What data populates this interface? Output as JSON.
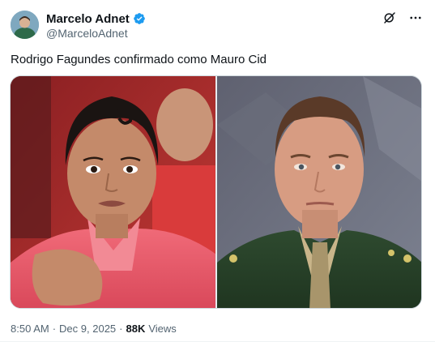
{
  "author": {
    "display_name": "Marcelo Adnet",
    "handle": "@MarceloAdnet",
    "verified": true
  },
  "post": {
    "text": "Rodrigo Fagundes confirmado como Mauro Cid",
    "time": "8:50 AM",
    "separator_1": "·",
    "date": "Dec 9, 2025",
    "separator_2": "·",
    "views_count": "88K",
    "views_label": "Views"
  },
  "icons": {
    "verified": "verified-badge-icon",
    "grok": "grok-icon",
    "more": "more-icon"
  },
  "colors": {
    "verified_blue": "#1d9bf0",
    "text_primary": "#0f1419",
    "text_secondary": "#536471",
    "border": "#cfd9de"
  }
}
